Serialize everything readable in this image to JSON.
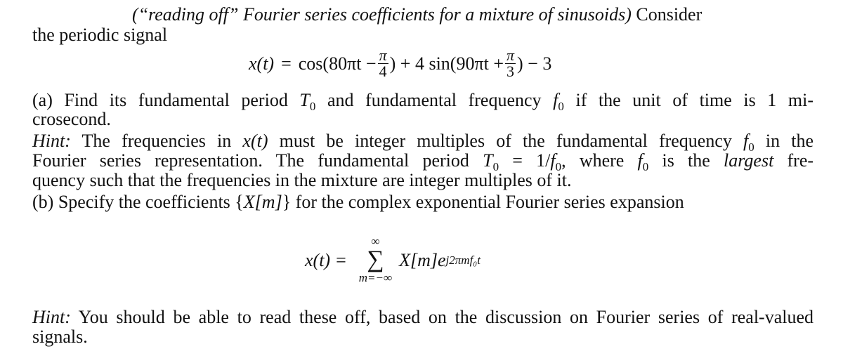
{
  "problem": {
    "title_italic": "(“reading off” Fourier series coefficients for a mixture of sinusoids)",
    "title_rest": " Consider",
    "line2": "the periodic signal",
    "equation1": {
      "lhs": "x(t)",
      "eq": "=",
      "cos_part": "cos(80πt −",
      "frac1_num": "π",
      "frac1_den": "4",
      "mid": ") + 4 sin(90πt +",
      "frac2_num": "π",
      "frac2_den": "3",
      "tail": ") − 3"
    },
    "part_a": {
      "line1_pre": "(a) Find its fundamental period ",
      "T": "T",
      "T_sub": "0",
      "line1_mid": " and fundamental frequency ",
      "f": "f",
      "f_sub": "0",
      "line1_post": " if the unit of time is 1 mi-",
      "line2": "crosecond."
    },
    "hint1": {
      "label": "Hint:",
      "l1_pre": " The frequencies in ",
      "l1_x": "x(t)",
      "l1_mid": " must be integer multiples of the fundamental frequency ",
      "l1_f": "f",
      "l1_fsub": "0",
      "l1_post": " in the",
      "l2_pre": "Fourier series representation.  The fundamental period ",
      "l2_T": "T",
      "l2_Tsub": "0",
      "l2_eq": " = 1/",
      "l2_f": "f",
      "l2_fsub": "0",
      "l2_mid": ", where ",
      "l2_f2": "f",
      "l2_f2sub": "0",
      "l2_is": " is the ",
      "l2_largest": "largest",
      "l2_post": " fre-",
      "l3": "quency such that the frequencies in the mixture are integer multiples of it."
    },
    "part_b": {
      "pre": "(b) Specify the coefficients {",
      "X": "X",
      "m": "[m]",
      "post": "} for the complex exponential Fourier series expansion"
    },
    "equation2": {
      "lhs": "x(t)",
      "eq": "=",
      "upper": "∞",
      "sigma": "∑",
      "lower": "m=−∞",
      "term": "X[m]e",
      "exponent": "j2πmf₀t"
    },
    "hint2": {
      "label": "Hint:",
      "line1": " You should be able to read these off, based on the discussion on Fourier series of real-valued",
      "line2": "signals."
    }
  }
}
